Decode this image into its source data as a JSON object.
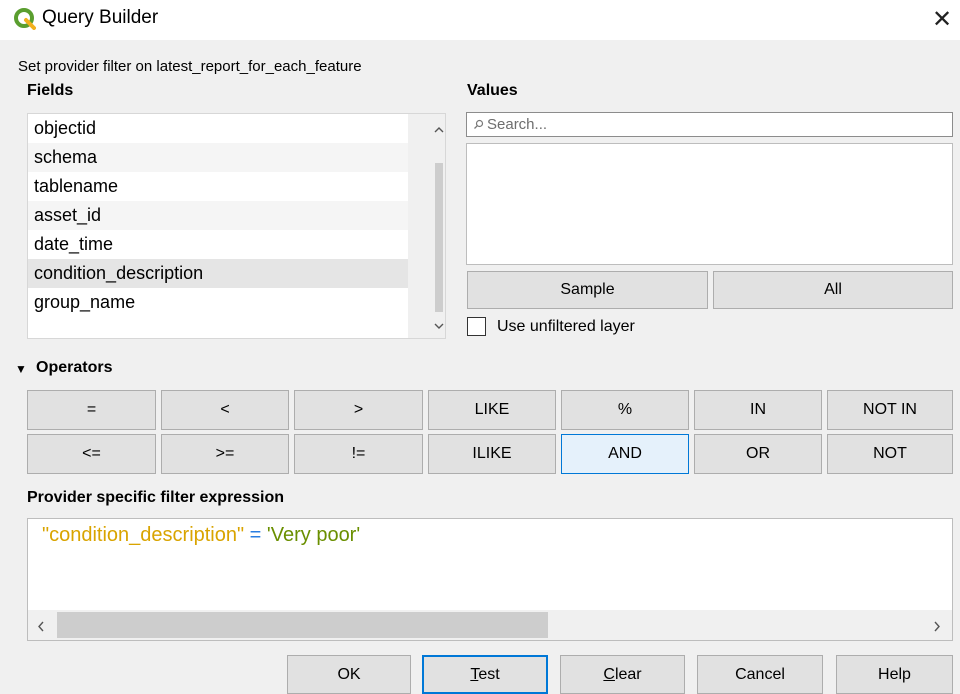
{
  "window": {
    "title": "Query Builder",
    "close_glyph": "✕"
  },
  "subtitle": "Set provider filter on latest_report_for_each_feature",
  "fields": {
    "title": "Fields",
    "items": [
      "objectid",
      "schema",
      "tablename",
      "asset_id",
      "date_time",
      "condition_description",
      "group_name"
    ],
    "selected": "condition_description"
  },
  "values": {
    "title": "Values",
    "search_placeholder": "Search...",
    "sample_label": "Sample",
    "all_label": "All",
    "unfiltered_label": "Use unfiltered layer"
  },
  "operators": {
    "title": "Operators",
    "row1": [
      "=",
      "<",
      ">",
      "LIKE",
      "%",
      "IN",
      "NOT IN"
    ],
    "row2": [
      "<=",
      ">=",
      "!=",
      "ILIKE",
      "AND",
      "OR",
      "NOT"
    ]
  },
  "expression": {
    "title": "Provider specific filter expression",
    "field_token": "\"condition_description\"",
    "operator_token": "=",
    "value_token": "'Very poor'"
  },
  "footer": {
    "ok": "OK",
    "test_mnemonic": "T",
    "test_rest": "est",
    "clear_mnemonic": "C",
    "clear_rest": "lear",
    "cancel": "Cancel",
    "help": "Help"
  },
  "colors": {
    "accent": "#0078d7",
    "field_token": "#d9a400",
    "operator_token": "#2a7de1",
    "string_token": "#6a8f00"
  }
}
